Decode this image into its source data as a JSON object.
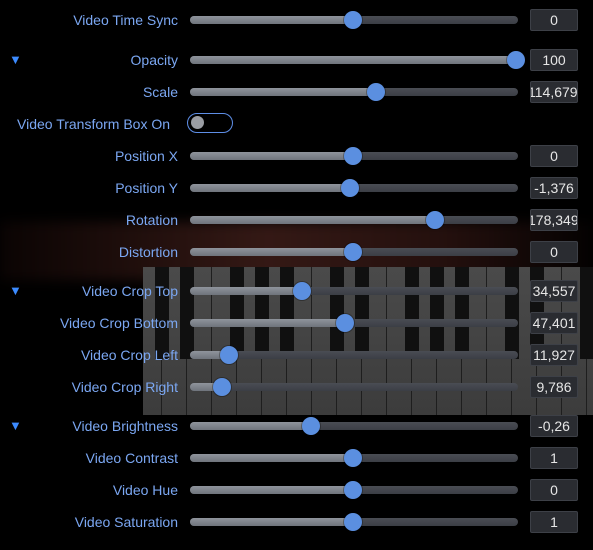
{
  "colors": {
    "label": "#7ba7f2",
    "accent": "#5b8fe0",
    "value_text": "#e6e6e6"
  },
  "icons": {
    "expand": "triangle-down-icon"
  },
  "rows": [
    {
      "label": "Video Time Sync",
      "value": "0",
      "level": 0.5,
      "expandable": false
    },
    {
      "label": "Opacity",
      "value": "100",
      "level": 1.0,
      "expandable": true
    },
    {
      "label": "Scale",
      "value": "114,679",
      "level": 0.57,
      "expandable": false
    },
    {
      "label": "Video Transform Box On",
      "toggle": true,
      "toggle_on": false
    },
    {
      "label": "Position X",
      "value": "0",
      "level": 0.5,
      "expandable": false
    },
    {
      "label": "Position Y",
      "value": "-1,376",
      "level": 0.49,
      "expandable": false
    },
    {
      "label": "Rotation",
      "value": "178,349",
      "level": 0.75,
      "expandable": false
    },
    {
      "label": "Distortion",
      "value": "0",
      "level": 0.5,
      "expandable": false
    },
    {
      "label": "Video Crop Top",
      "value": "34,557",
      "level": 0.345,
      "expandable": true
    },
    {
      "label": "Video Crop Bottom",
      "value": "47,401",
      "level": 0.475,
      "expandable": false
    },
    {
      "label": "Video Crop Left",
      "value": "11,927",
      "level": 0.12,
      "expandable": false
    },
    {
      "label": "Video Crop Right",
      "value": "9,786",
      "level": 0.098,
      "expandable": false
    },
    {
      "label": "Video Brightness",
      "value": "-0,26",
      "level": 0.37,
      "expandable": true
    },
    {
      "label": "Video Contrast",
      "value": "1",
      "level": 0.5,
      "expandable": false
    },
    {
      "label": "Video Hue",
      "value": "0",
      "level": 0.5,
      "expandable": false
    },
    {
      "label": "Video Saturation",
      "value": "1",
      "level": 0.5,
      "expandable": false
    }
  ]
}
